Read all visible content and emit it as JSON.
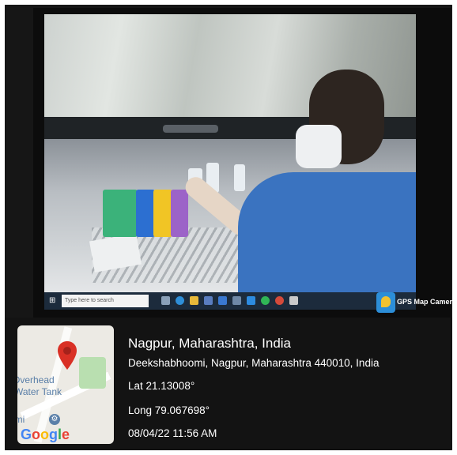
{
  "taskbar": {
    "search_placeholder": "Type here to search"
  },
  "overlay": {
    "app_label": "GPS Map Camera"
  },
  "location": {
    "place": "Nagpur, Maharashtra, India",
    "address": "Deekshabhoomi, Nagpur, Maharashtra 440010, India",
    "lat": "Lat 21.13008°",
    "long": "Long 79.067698°",
    "datetime": "08/04/22 11:56 AM"
  },
  "map": {
    "label_line1": "Overhead",
    "label_line2": "Water Tank",
    "label_line3": "omi",
    "brand": "Google",
    "brand_colors": [
      "#4285F4",
      "#EA4335",
      "#FBBC05",
      "#4285F4",
      "#34A853",
      "#EA4335"
    ],
    "pin_color": "#d93025"
  }
}
